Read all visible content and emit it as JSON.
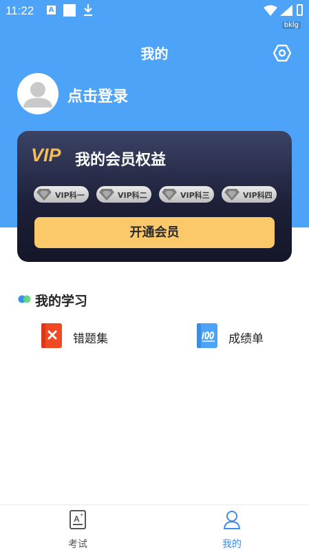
{
  "status_bar": {
    "time": "11:22",
    "a_icon": "A",
    "sub_label": "bklg"
  },
  "header": {
    "title": "我的"
  },
  "profile": {
    "login_label": "点击登录"
  },
  "vip": {
    "logo": "VIP",
    "title": "我的会员权益",
    "badges": [
      {
        "label": "VIP科一"
      },
      {
        "label": "VIP科二"
      },
      {
        "label": "VIP科三"
      },
      {
        "label": "VIP科四"
      }
    ],
    "button_label": "开通会员"
  },
  "study": {
    "title": "我的学习",
    "items": [
      {
        "label": "错题集",
        "icon": "wrong-questions-icon"
      },
      {
        "label": "成绩单",
        "icon": "score-report-icon"
      }
    ]
  },
  "tabbar": {
    "tabs": [
      {
        "label": "考试",
        "icon": "exam-icon",
        "active": false
      },
      {
        "label": "我的",
        "icon": "profile-icon",
        "active": true
      }
    ]
  },
  "colors": {
    "primary": "#4da3f7",
    "vip_gold": "#f5bd58",
    "vip_button": "#fcc96a",
    "tab_active": "#3d8cf0"
  }
}
